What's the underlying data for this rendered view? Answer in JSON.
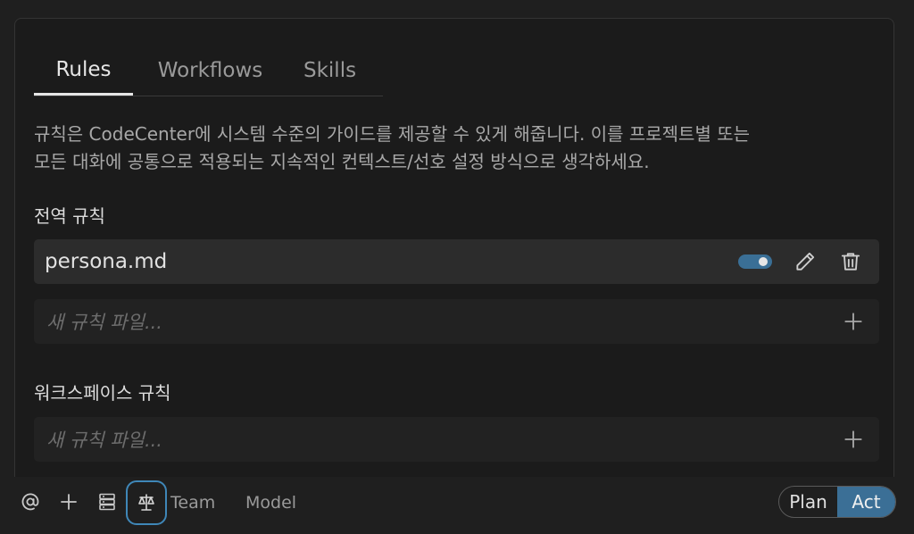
{
  "tabs": [
    {
      "label": "Rules",
      "active": true
    },
    {
      "label": "Workflows",
      "active": false
    },
    {
      "label": "Skills",
      "active": false
    }
  ],
  "description": {
    "line1": "규칙은 CodeCenter에 시스템 수준의 가이드를 제공할 수 있게 해줍니다. 이를 프로젝트별 또는",
    "line2": "모든 대화에 공통으로 적용되는 지속적인 컨텍스트/선호 설정 방식으로 생각하세요."
  },
  "global_rules": {
    "title": "전역 규칙",
    "items": [
      {
        "name": "persona.md",
        "enabled": true
      }
    ],
    "new_placeholder": "새 규칙 파일..."
  },
  "workspace_rules": {
    "title": "워크스페이스 규칙",
    "new_placeholder": "새 규칙 파일..."
  },
  "bottom_bar": {
    "team_label": "Team",
    "model_label": "Model",
    "mode": {
      "plan_label": "Plan",
      "act_label": "Act",
      "selected": "Act"
    }
  },
  "icons": [
    "at-icon",
    "plus-icon",
    "server-icon",
    "scale-icon",
    "pencil-icon",
    "trash-icon"
  ],
  "colors": {
    "accent": "#3b6f96",
    "accent_border": "#3f87b8",
    "background": "#1f1f1f"
  }
}
